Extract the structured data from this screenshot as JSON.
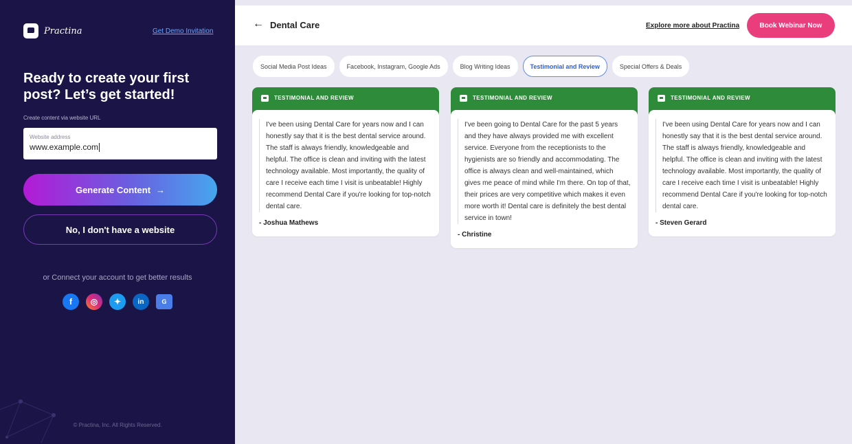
{
  "brand": {
    "name": "Practina",
    "demo_link": "Get Demo Invitation"
  },
  "left": {
    "headline": "Ready to create your first post? Let’s get started!",
    "sub_label": "Create content via website URL",
    "url_field": {
      "label": "Website address",
      "value": "www.example.com"
    },
    "generate_button": "Generate Content",
    "generate_arrow": "→",
    "no_website_button": "No, I don't have a website",
    "connect_text": "or Connect your account to get better results",
    "socials": [
      "facebook-icon",
      "instagram-icon",
      "twitter-icon",
      "linkedin-icon",
      "google-my-business-icon"
    ],
    "social_glyphs": {
      "facebook": "f",
      "instagram": "◎",
      "twitter": "✦",
      "linkedin": "in",
      "gmb": "G"
    },
    "copyright": "© Practina, Inc. All Rights Reserved."
  },
  "topbar": {
    "back_arrow": "←",
    "title": "Dental Care",
    "explore_link": "Explore more about Practina",
    "webinar_button": "Book Webinar Now"
  },
  "tabs": [
    {
      "label": "Social Media Post Ideas",
      "active": false
    },
    {
      "label": "Facebook, Instagram, Google Ads",
      "active": false
    },
    {
      "label": "Blog Writing Ideas",
      "active": false
    },
    {
      "label": "Testimonial and Review",
      "active": true
    },
    {
      "label": "Special Offers & Deals",
      "active": false
    }
  ],
  "cards": [
    {
      "header": "TESTIMONIAL AND REVIEW",
      "text": "I've been using Dental Care for years now and I can honestly say that it is the best dental service around. The staff is always friendly, knowledgeable and helpful. The office is clean and inviting with the latest technology available. Most importantly, the quality of care I receive each time I visit is unbeatable! Highly recommend Dental Care if you're looking for top-notch dental care.",
      "author": "- Joshua Mathews"
    },
    {
      "header": "TESTIMONIAL AND REVIEW",
      "text": "I've been going to Dental Care for the past 5 years and they have always provided me with excellent service. Everyone from the receptionists to the hygienists are so friendly and accommodating. The office is always clean and well-maintained, which gives me peace of mind while I'm there. On top of that, their prices are very competitive which makes it even more worth it! Dental care is definitely the best dental service in town!",
      "author": "- Christine"
    },
    {
      "header": "TESTIMONIAL AND REVIEW",
      "text": "I've been using Dental Care for years now and I can honestly say that it is the best dental service around. The staff is always friendly, knowledgeable and helpful. The office is clean and inviting with the latest technology available. Most importantly, the quality of care I receive each time I visit is unbeatable! Highly recommend Dental Care if you're looking for top-notch dental care.",
      "author": "- Steven Gerard"
    }
  ],
  "colors": {
    "sidebar_bg": "#1b1446",
    "card_header": "#2e8b3a",
    "webinar_button": "#ea3e7c",
    "active_tab_border": "#5b8dee",
    "page_bg": "#e9e8f2"
  }
}
